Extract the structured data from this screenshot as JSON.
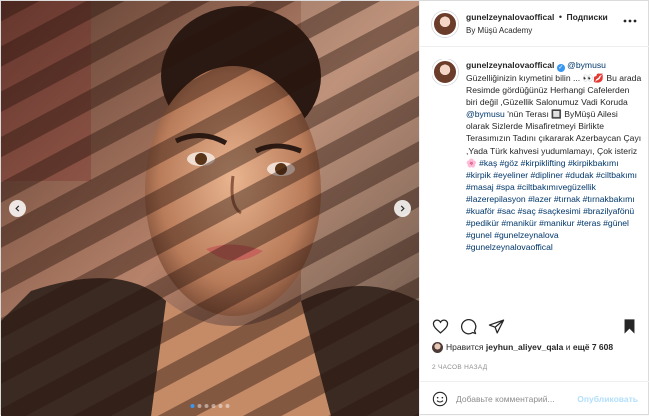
{
  "header": {
    "username": "gunelzeynalovaoffical",
    "separator": "•",
    "follow_label": "Подписки",
    "location": "By Müşü Academy",
    "more_icon": "ellipsis-icon"
  },
  "caption": {
    "username": "gunelzeynalovaoffical",
    "mention": "@bymusu",
    "line1": "Güzelliğinizin kıymetini bilin ... ",
    "line1_emoji": "👀💋",
    "line2": "Bu arada Resimde gördüğünüz Herhangi Cafelerden biri değil ,Güzellik Salonumuz Vadi Koruda ",
    "mention2": "@bymusu",
    "line3": " 'nün Terası 🔲 ByMüşü Ailesi olarak Sizlerde Misafiretmeyi Birlikte Terasımızın Tadını çıkararak Azerbaycan Çayı ,Yada Türk kahvesi yudumlamayı, Çok isteriz🌸 ",
    "hashtags": [
      "#kaş",
      "#göz",
      "#kirpiklifting",
      "#kirpikbakımı",
      "#kirpik",
      "#eyeliner",
      "#dipliner",
      "#dudak",
      "#ciltbakımı",
      "#masaj",
      "#spa",
      "#ciltbakımıvegüzellik",
      "#lazerepilasyon",
      "#lazer",
      "#tırnak",
      "#tırnakbakımı",
      "#kuaför",
      "#sac",
      "#saç",
      "#saçkesimi",
      "#brazilyafönü",
      "#pedikür",
      "#manikür",
      "#manikur",
      "#teras",
      "#günel",
      "#gunel",
      "#gunelzeynalova",
      "#gunelzeynalovaoffical"
    ]
  },
  "actions": {
    "like_icon": "heart-icon",
    "comment_icon": "comment-icon",
    "share_icon": "share-icon",
    "save_icon": "bookmark-icon"
  },
  "likes": {
    "prefix": "Нравится ",
    "user": "jeyhun_aliyev_qala",
    "middle": " и ",
    "count": "ещё 7 608"
  },
  "time": "2 ЧАСОВ НАЗАД",
  "comment_box": {
    "placeholder": "Добавьте комментарий...",
    "publish_label": "Опубликовать"
  },
  "carousel": {
    "total": 6,
    "active": 0
  },
  "colors": {
    "link": "#00376b",
    "accent": "#3897f0",
    "muted": "#8e8e8e"
  }
}
